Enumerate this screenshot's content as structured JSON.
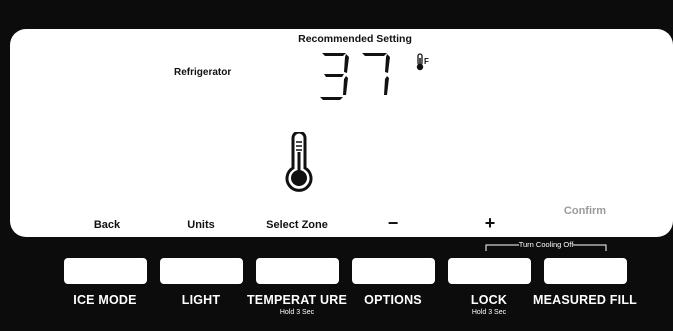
{
  "display": {
    "header": "Recommended Setting",
    "zone": "Refrigerator",
    "temperature": "37",
    "unit": "F",
    "soft_keys": {
      "back": "Back",
      "units": "Units",
      "select_zone": "Select Zone",
      "minus": "−",
      "plus": "+",
      "confirm": "Confirm"
    }
  },
  "buttons": [
    {
      "label": "ICE MODE",
      "sub": ""
    },
    {
      "label": "LIGHT",
      "sub": ""
    },
    {
      "label": "TEMPERAT URE",
      "sub": "Hold 3 Sec"
    },
    {
      "label": "OPTIONS",
      "sub": ""
    },
    {
      "label": "LOCK",
      "sub": "Hold 3 Sec"
    },
    {
      "label": "MEASURED FILL",
      "sub": ""
    }
  ],
  "cooling_off_label": "Turn Cooling Off",
  "colors": {
    "background": "#0c0c0c",
    "display": "#ffffff",
    "confirm_text": "#9a9a9a"
  }
}
